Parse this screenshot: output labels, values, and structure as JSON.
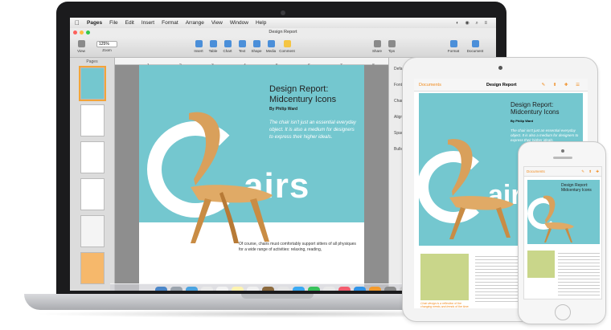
{
  "menubar": {
    "apple": "",
    "items": [
      "Pages",
      "File",
      "Edit",
      "Insert",
      "Format",
      "Arrange",
      "View",
      "Window",
      "Help"
    ]
  },
  "window": {
    "title": "Design Report",
    "zoom_value": "125%",
    "toolbar": {
      "view": "View",
      "zoom": "Zoom",
      "insert": "Insert",
      "table": "Table",
      "chart": "Chart",
      "text": "Text",
      "shape": "Shape",
      "media": "Media",
      "comment": "Comment",
      "share": "Share",
      "tips": "Tips",
      "format": "Format",
      "document": "Document"
    },
    "pages_label": "Pages",
    "ruler_numbers": [
      "1",
      "2",
      "3",
      "4",
      "5",
      "6",
      "7",
      "8"
    ],
    "inspector_labels": [
      "Defa",
      "Font",
      "Chara",
      "Align",
      "Spac",
      "Bulle"
    ]
  },
  "document": {
    "title_line1": "Design Report:",
    "title_line2": "Midcentury Icons",
    "author": "By Philip Ward",
    "quote": "The chair isn't just an essential everyday object. It is also a medium for designers to express their higher ideals.",
    "big_letter": "C",
    "big_word": "airs",
    "body": "Of course, chairs must comfortably support sitters of all physiques for a wide range of activities: relaxing, reading,"
  },
  "ipad": {
    "nav": "Documents",
    "doc_title": "Design Report",
    "heading1": "Design Report:",
    "heading2": "Midcentury Icons",
    "author": "By Philip Ward",
    "quote": "The chair isn't just an essential everyday object. It is also a medium for designers to express their higher ideals.",
    "big_word": "airs",
    "caption": "Chair design is a reflection of the changing needs and trends of the time."
  },
  "iphone": {
    "nav": "Documents",
    "heading1": "Design Report:",
    "heading2": "Midcentury Icons"
  },
  "colors": {
    "teal": "#74c7cf",
    "wood": "#d9a05b",
    "accent": "#f08a1c"
  }
}
